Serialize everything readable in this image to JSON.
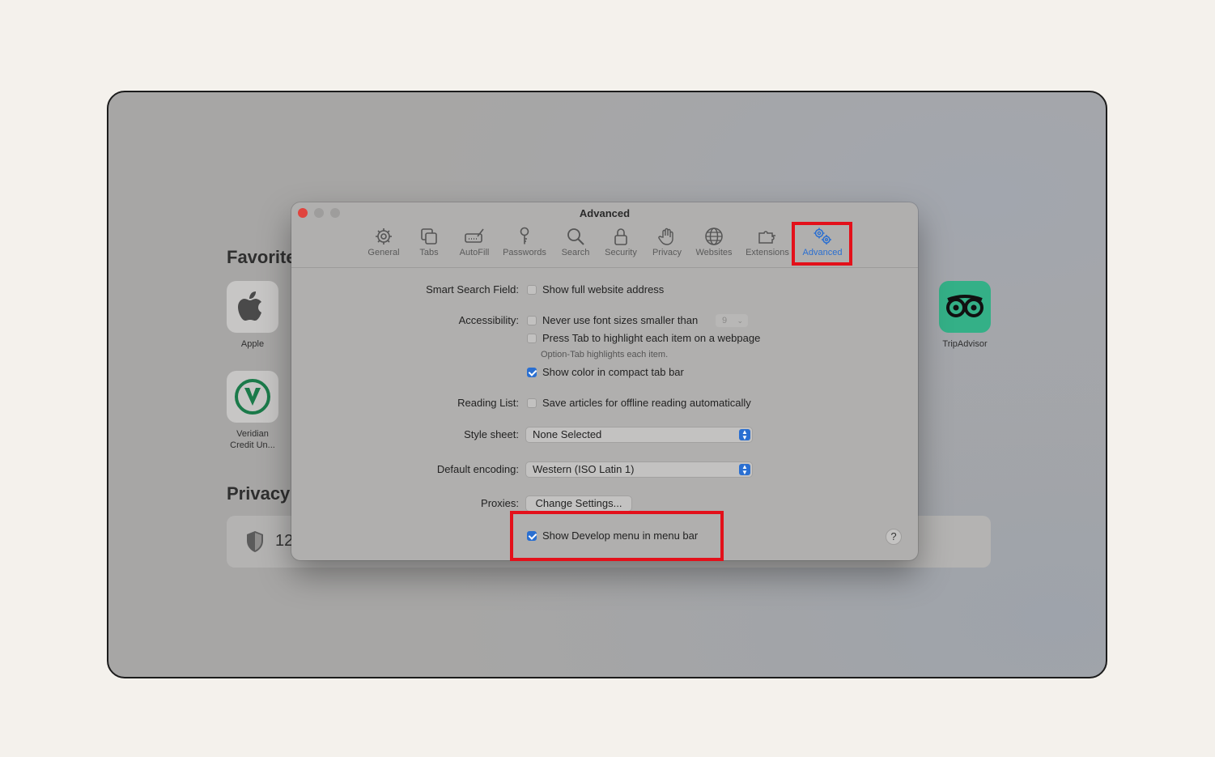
{
  "background": {
    "favorites_heading": "Favorite",
    "privacy_heading": "Privacy",
    "privacy_count": "12",
    "favorites": [
      {
        "label": "Apple"
      },
      {
        "label": "TripAdvisor"
      },
      {
        "label": "Veridian\nCredit Un..."
      }
    ]
  },
  "window": {
    "title": "Advanced",
    "toolbar": [
      {
        "label": "General",
        "icon": "gear-icon"
      },
      {
        "label": "Tabs",
        "icon": "tabs-icon"
      },
      {
        "label": "AutoFill",
        "icon": "autofill-icon"
      },
      {
        "label": "Passwords",
        "icon": "key-icon"
      },
      {
        "label": "Search",
        "icon": "search-icon"
      },
      {
        "label": "Security",
        "icon": "lock-icon"
      },
      {
        "label": "Privacy",
        "icon": "hand-icon"
      },
      {
        "label": "Websites",
        "icon": "globe-icon"
      },
      {
        "label": "Extensions",
        "icon": "puzzle-icon"
      },
      {
        "label": "Advanced",
        "icon": "gears-icon",
        "active": true
      }
    ],
    "smart_search": {
      "label": "Smart Search Field:",
      "option": "Show full website address",
      "checked": false
    },
    "accessibility": {
      "label": "Accessibility:",
      "font_option": "Never use font sizes smaller than",
      "font_size": "9",
      "tab_option": "Press Tab to highlight each item on a webpage",
      "tab_hint": "Option-Tab highlights each item.",
      "color_option": "Show color in compact tab bar",
      "color_checked": true
    },
    "reading_list": {
      "label": "Reading List:",
      "option": "Save articles for offline reading automatically",
      "checked": false
    },
    "style_sheet": {
      "label": "Style sheet:",
      "value": "None Selected"
    },
    "encoding": {
      "label": "Default encoding:",
      "value": "Western (ISO Latin 1)"
    },
    "proxies": {
      "label": "Proxies:",
      "button": "Change Settings..."
    },
    "develop_menu": {
      "option": "Show Develop menu in menu bar",
      "checked": true
    },
    "help": "?"
  },
  "colors": {
    "highlight": "#e3101a",
    "accent": "#2a6fd1",
    "close": "#e0443e",
    "tripadvisor": "#34b087",
    "veridian": "#1b7a4a"
  }
}
